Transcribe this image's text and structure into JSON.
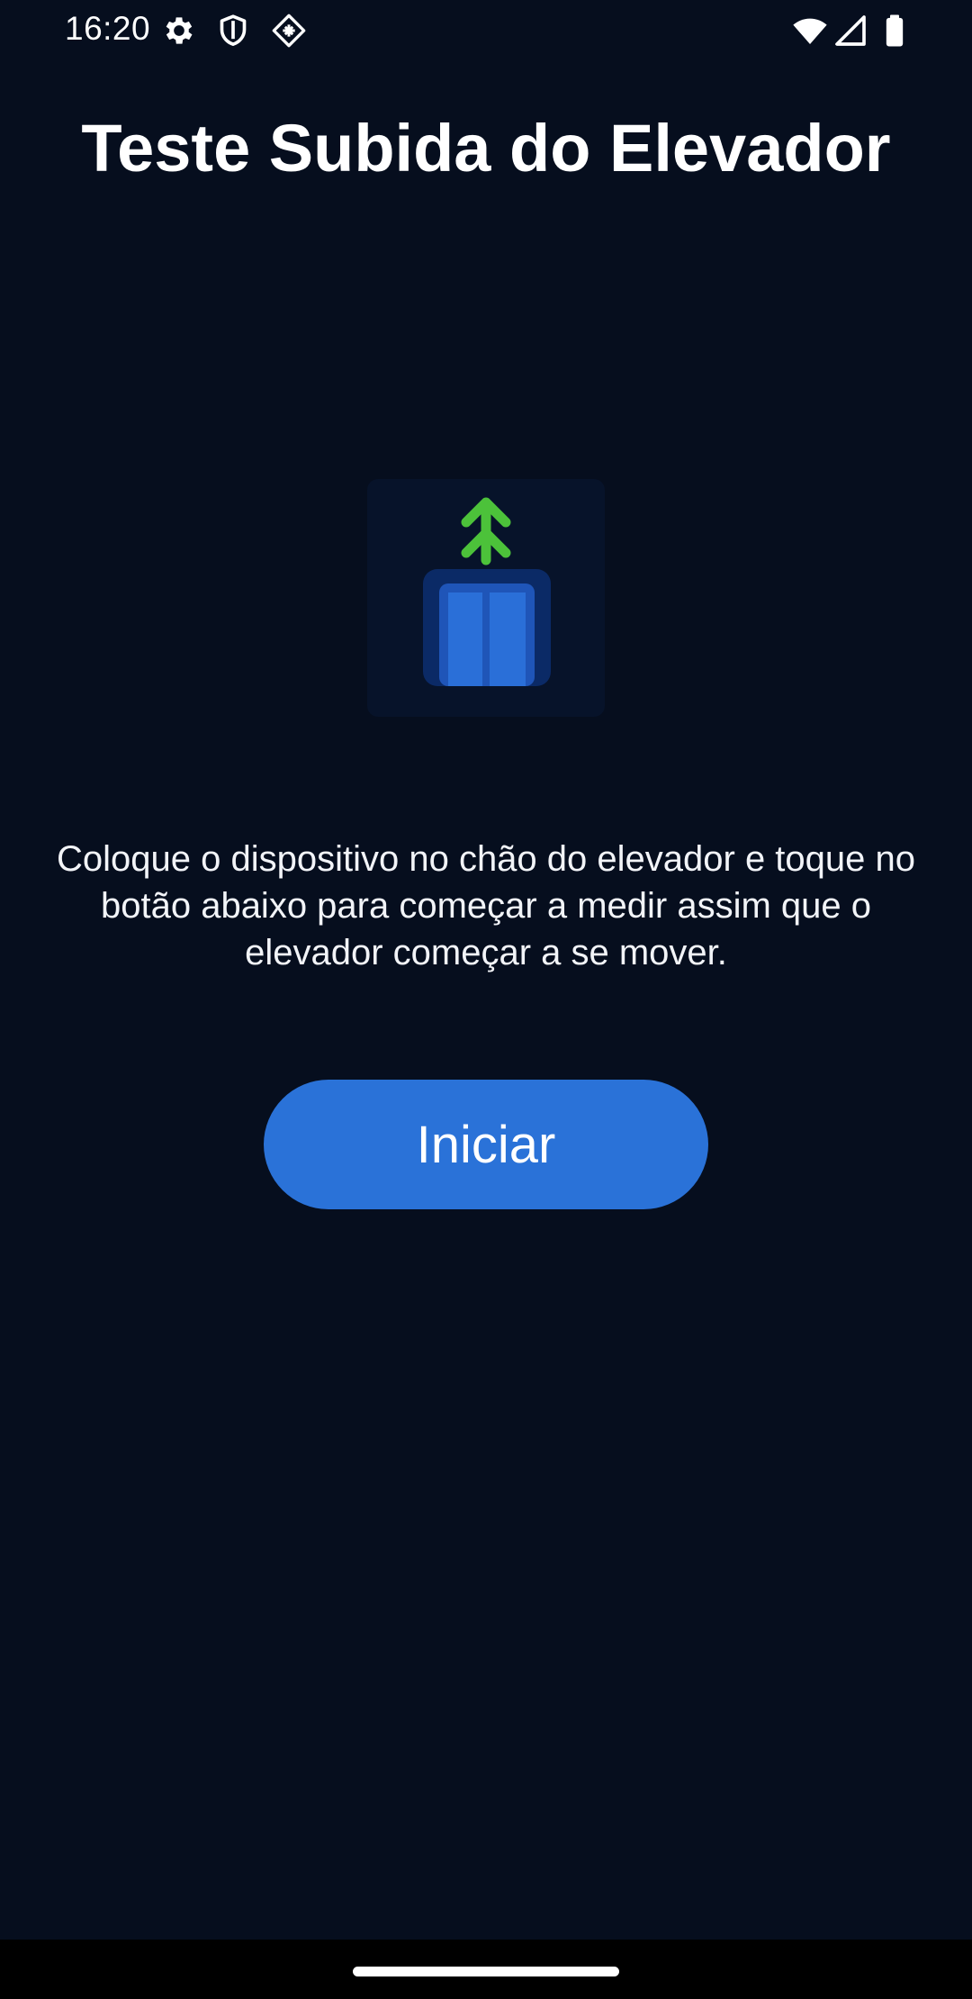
{
  "status_bar": {
    "time": "16:20",
    "left_icons": [
      "gear-icon",
      "shield-icon",
      "cube-icon"
    ],
    "right_icons": [
      "wifi-icon",
      "cellular-signal-icon",
      "battery-icon"
    ]
  },
  "page": {
    "title": "Teste Subida do Elevador",
    "illustration": {
      "icon": "elevator-up-icon",
      "arrow_color": "#4cc23a",
      "door_color": "#2a6fd8"
    },
    "instructions": "Coloque o dispositivo no chão do elevador e toque no botão abaixo para começar a medir assim que o elevador começar a se mover.",
    "start_button_label": "Iniciar"
  },
  "colors": {
    "background": "#060e1e",
    "accent": "#2a72d8"
  }
}
